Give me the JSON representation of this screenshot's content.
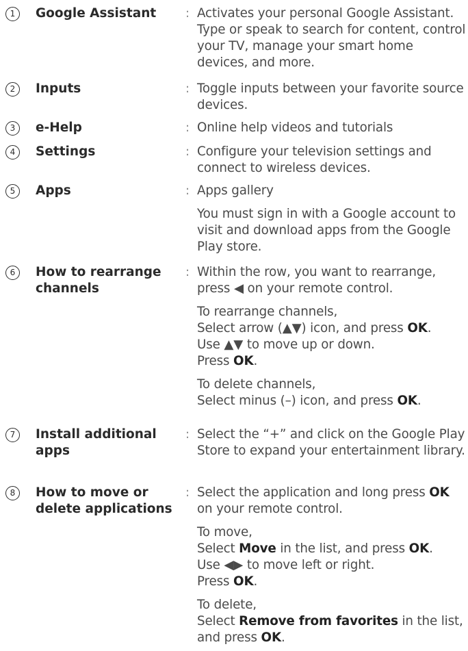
{
  "items": [
    {
      "number": "1",
      "label": "Google Assistant",
      "colon": ":",
      "desc": "Activates your personal Google Assistant. Type or speak to search for content, control your TV, manage your smart home devices, and more."
    },
    {
      "number": "2",
      "label": "Inputs",
      "colon": ":",
      "desc": "Toggle inputs between your favorite source devices."
    },
    {
      "number": "3",
      "label": "e-Help",
      "colon": ":",
      "desc": "Online help videos and tutorials"
    },
    {
      "number": "4",
      "label": "Settings",
      "colon": ":",
      "desc": "Configure your television settings and connect to wireless devices."
    },
    {
      "number": "5",
      "label": "Apps",
      "colon": ":",
      "desc": "Apps gallery",
      "desc2": "You must sign in with a Google account to visit and download apps from the Google Play store."
    },
    {
      "number": "6",
      "label": "How to rearrange channels",
      "colon": ":",
      "desc_a": "Within the row, you want to rearrange, press",
      "arrow_left": "◀",
      "desc_b": "on your remote control.",
      "rearrange_title": "To rearrange channels,",
      "rearrange_select_a": "Select arrow (",
      "up_down_arrows": "▲▼",
      "rearrange_select_b": ") icon, and press",
      "ok": "OK",
      "period": ".",
      "use": "Use",
      "use_b": "to move up or down.",
      "press": "Press",
      "delete_title": "To delete channels,",
      "delete_select": "Select minus (–) icon, and press"
    },
    {
      "number": "7",
      "label": "Install additional apps",
      "colon": ":",
      "desc": "Select the “+” and click on the Google Play Store to expand your entertainment library."
    },
    {
      "number": "8",
      "label": "How to move or delete applications",
      "colon": ":",
      "desc_a": "Select the application and long press",
      "ok": "OK",
      "desc_b": "on your remote control.",
      "move_title": "To move,",
      "select": "Select",
      "move_word": "Move",
      "in_list": "in the list, and press",
      "period": ".",
      "use": "Use",
      "left_right_arrows": "◀▶",
      "use_b": "to move left or right.",
      "press": "Press",
      "delete_title": "To delete,",
      "remove_word": "Remove from favorites",
      "in_list_comma": "in the list,",
      "and_press": "and press"
    }
  ]
}
